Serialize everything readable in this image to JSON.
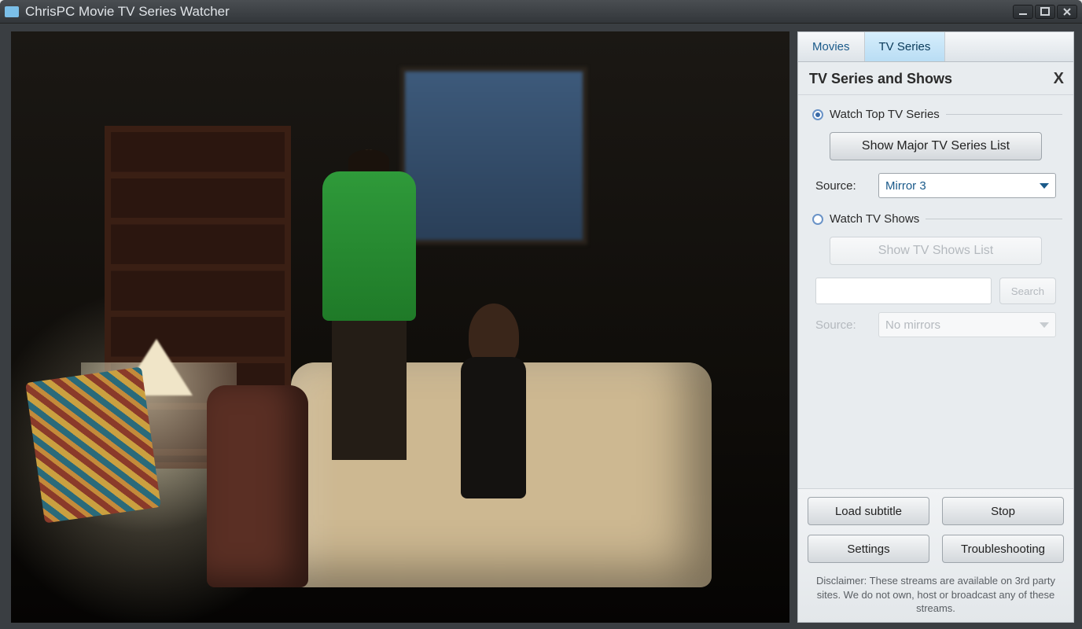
{
  "titlebar": {
    "title": "ChrisPC Movie TV Series Watcher"
  },
  "tabs": {
    "movies": "Movies",
    "tv_series": "TV Series"
  },
  "panel": {
    "heading": "TV Series and Shows",
    "close": "X",
    "group_top": {
      "label": "Watch Top TV Series",
      "button": "Show Major TV Series List",
      "source_label": "Source:",
      "source_value": "Mirror 3"
    },
    "group_shows": {
      "label": "Watch TV Shows",
      "button": "Show TV Shows List",
      "search_button": "Search",
      "search_value": "",
      "source_label": "Source:",
      "source_value": "No mirrors"
    }
  },
  "bottom": {
    "load_subtitle": "Load subtitle",
    "stop": "Stop",
    "settings": "Settings",
    "troubleshooting": "Troubleshooting",
    "disclaimer": "Disclaimer: These streams are available on 3rd party sites. We do not own, host or broadcast any of these streams."
  }
}
